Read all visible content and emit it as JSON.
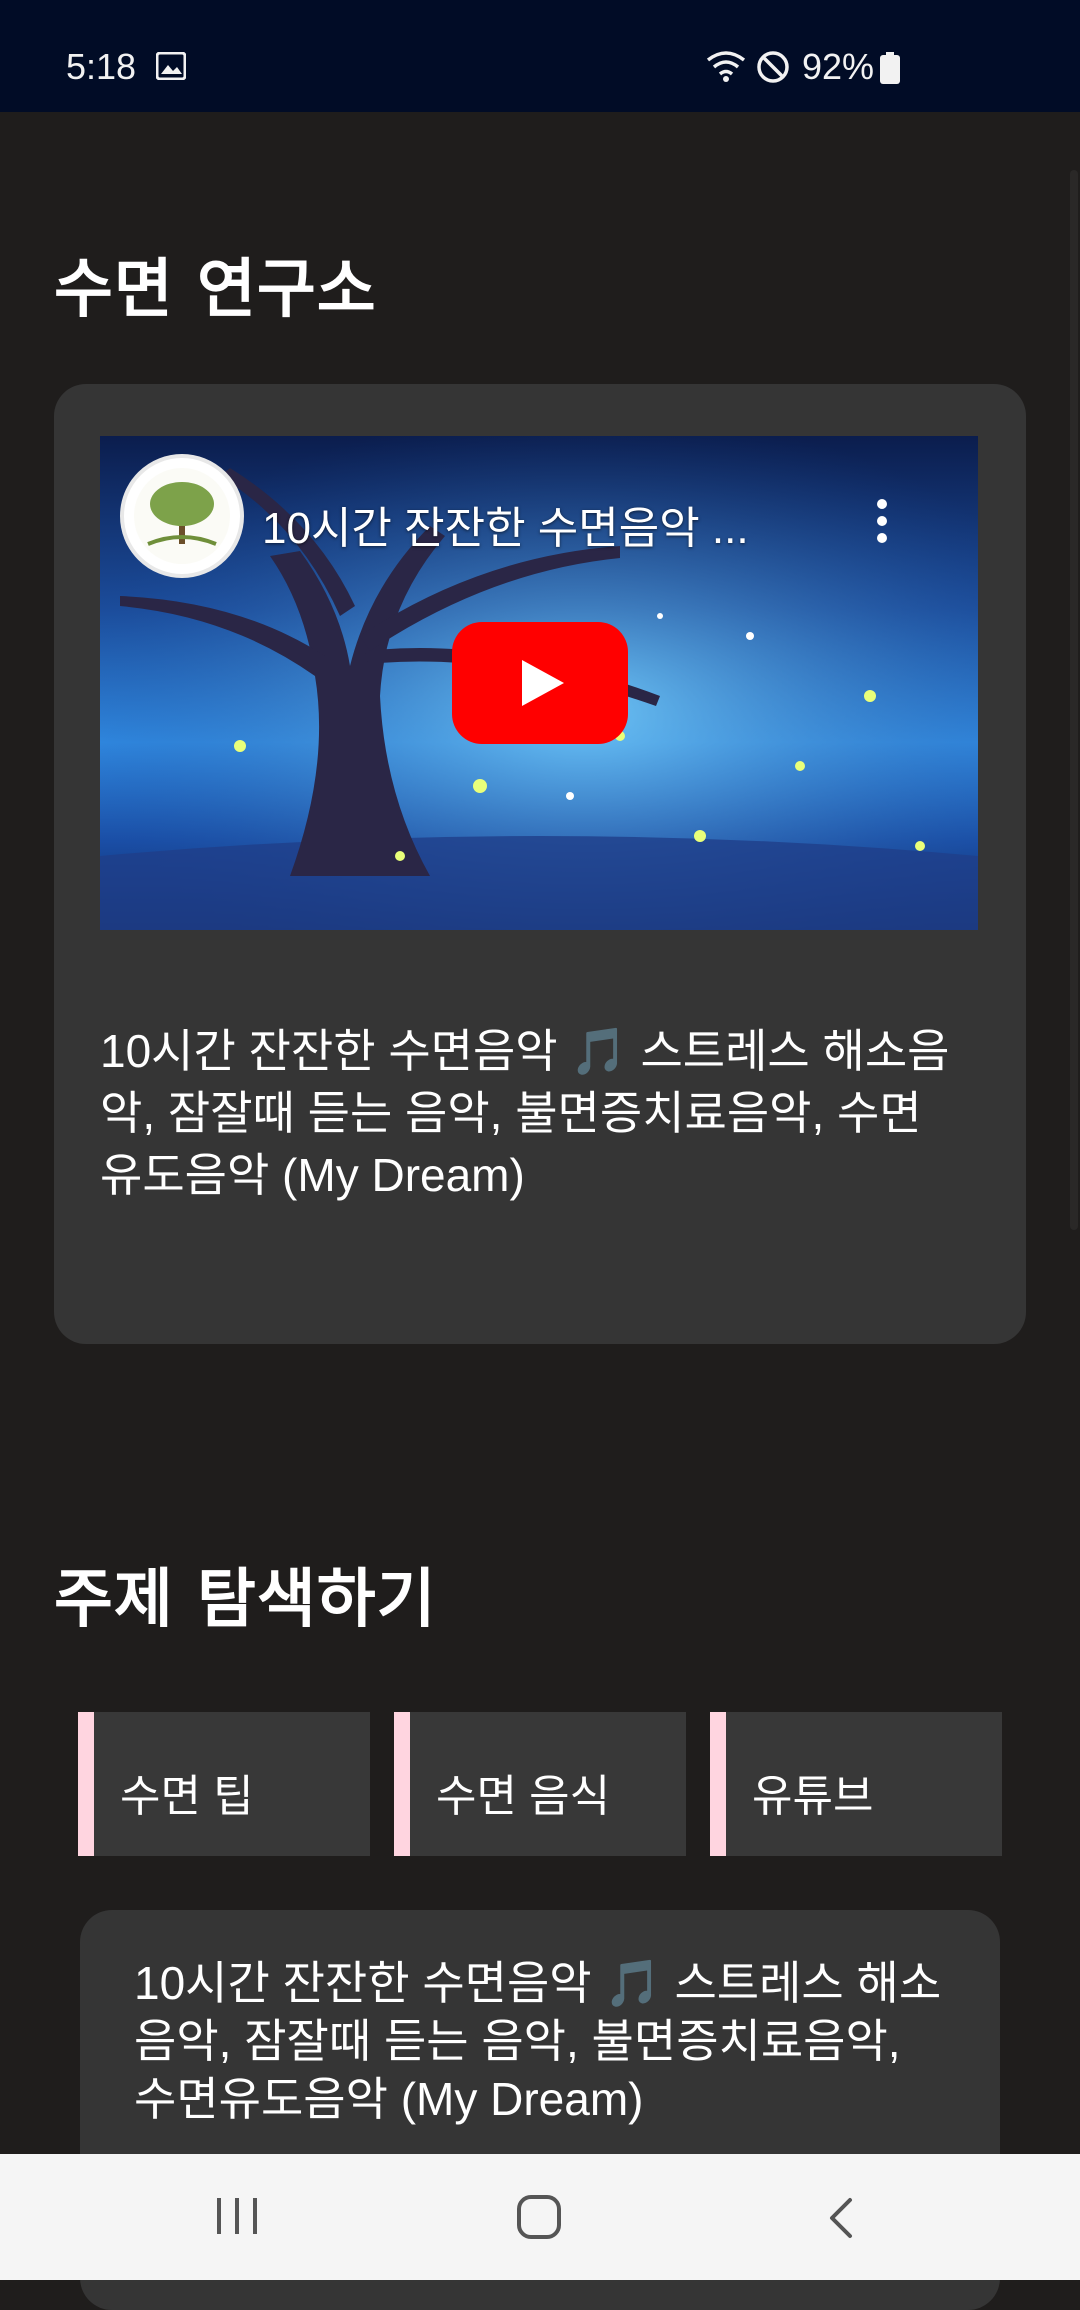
{
  "status_bar": {
    "time": "5:18",
    "battery_text": "92%",
    "icons": [
      "gallery-icon",
      "wifi-icon",
      "do-not-disturb-icon",
      "battery-icon"
    ]
  },
  "sleep_section": {
    "title": "수면 연구소",
    "video": {
      "overlay_title": "10시간 잔잔한 수면음악 ...",
      "description": "10시간 잔잔한 수면음악 🎵 스트레스 해소음악, 잠잘때 듣는 음악, 불면증치료음악, 수면유도음악 (My Dream)"
    }
  },
  "explore_section": {
    "title": "주제 탐색하기",
    "tabs": [
      {
        "label": "수면 팁"
      },
      {
        "label": "수면 음식"
      },
      {
        "label": "유튜브"
      }
    ],
    "result_card": {
      "description": "10시간 잔잔한 수면음악 🎵 스트레스 해소음악, 잠잘때 듣는 음악, 불면증치료음악, 수면유도음악 (My Dream)"
    }
  },
  "colors": {
    "background": "#1f1d1c",
    "status_bar": "#010c26",
    "card": "#353535",
    "tab_accent": "#ffd5e0",
    "youtube_red": "#ff0000"
  }
}
